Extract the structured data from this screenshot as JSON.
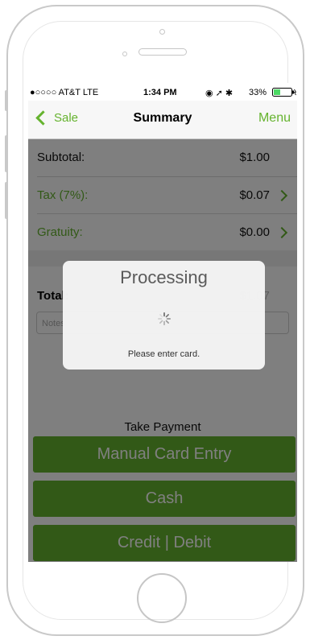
{
  "status_bar": {
    "carrier": "●○○○○ AT&T  LTE",
    "time": "1:34 PM",
    "indicators": "◉ ➚ ✱",
    "battery": "33%"
  },
  "nav": {
    "back_label": "Sale",
    "title": "Summary",
    "menu_label": "Menu"
  },
  "summary": {
    "subtotal_label": "Subtotal:",
    "subtotal_value": "$1.00",
    "tax_label": "Tax (7%):",
    "tax_value": "$0.07",
    "gratuity_label": "Gratuity:",
    "gratuity_value": "$0.00",
    "total_label": "Total:",
    "total_value": "$1.07",
    "notes_placeholder": "Notes"
  },
  "payment": {
    "heading": "Take Payment",
    "buttons": [
      "Manual Card Entry",
      "Cash",
      "Credit | Debit"
    ]
  },
  "dialog": {
    "title": "Processing",
    "message": "Please enter card."
  },
  "colors": {
    "accent": "#65b32e",
    "overlay": "rgba(0,0,0,0.5)"
  }
}
